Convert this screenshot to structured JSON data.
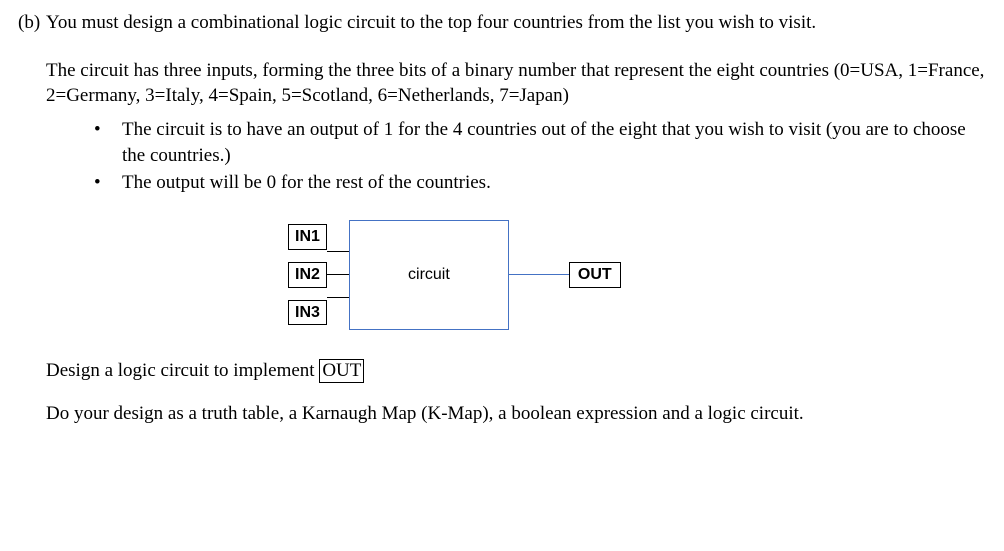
{
  "question": {
    "label": "(b)",
    "text": "You must design a combinational logic circuit to the top four countries from the list you wish to visit."
  },
  "para1": "The circuit has three inputs, forming the three bits of a binary number that represent the eight countries (0=USA, 1=France, 2=Germany, 3=Italy, 4=Spain, 5=Scotland, 6=Netherlands, 7=Japan)",
  "bullets": [
    "The circuit is to have an output of 1 for the 4 countries out of the eight that you wish to visit (you are to choose the countries.)",
    "The output will be 0 for the rest of the countries."
  ],
  "diagram": {
    "in1": "IN1",
    "in2": "IN2",
    "in3": "IN3",
    "circuit": "circuit",
    "out": "OUT"
  },
  "design_prefix": "Design a logic circuit to implement ",
  "design_out": "OUT",
  "final": "Do your design as a truth table, a Karnaugh Map (K-Map), a boolean expression and a logic circuit."
}
